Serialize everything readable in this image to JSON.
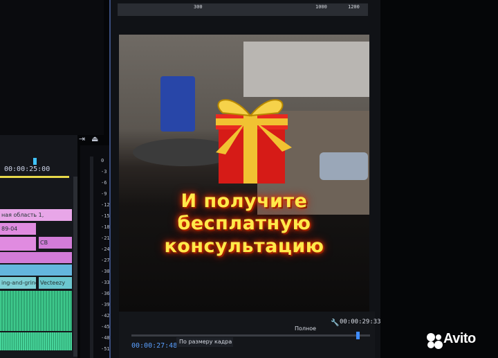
{
  "timeline": {
    "timecode": "00:00:25:00",
    "clips": [
      {
        "label": "ная область 1,",
        "color": "#e8a6e8"
      },
      {
        "label": "89-04",
        "color": "#e08be0"
      },
      {
        "label": "CB",
        "color": "#d27cd8"
      },
      {
        "label": "ing-and-grinding",
        "color": "#7fd0d6"
      },
      {
        "label": "Vecteezy",
        "color": "#6bc7cf"
      }
    ]
  },
  "meter": {
    "ticks": [
      "0",
      "-3",
      "-6",
      "-9",
      "-12",
      "-15",
      "-18",
      "-21",
      "-24",
      "-27",
      "-30",
      "-33",
      "-36",
      "-39",
      "-42",
      "-45",
      "-48",
      "-51"
    ]
  },
  "ruler": {
    "labels": [
      "300",
      "1000",
      "1200"
    ]
  },
  "video": {
    "promo_lines": [
      "И получите",
      "бесплатную",
      "консультацию"
    ]
  },
  "monitor": {
    "current_timecode": "00:00:27:48",
    "fit_option": "По размеру кадра",
    "quality_option": "Полное",
    "duration_timecode": "00:00:29:33"
  },
  "icons": {
    "filter": "funnel-icon",
    "insert": "insert-icon",
    "export": "export-icon",
    "wrench": "wrench-icon"
  },
  "watermark": {
    "brand": "Avito",
    "color_dot_1": "#00aaff",
    "color_dot_2": "#a169f7",
    "color_dot_3": "#ff4053",
    "color_dot_4": "#97cf26"
  }
}
